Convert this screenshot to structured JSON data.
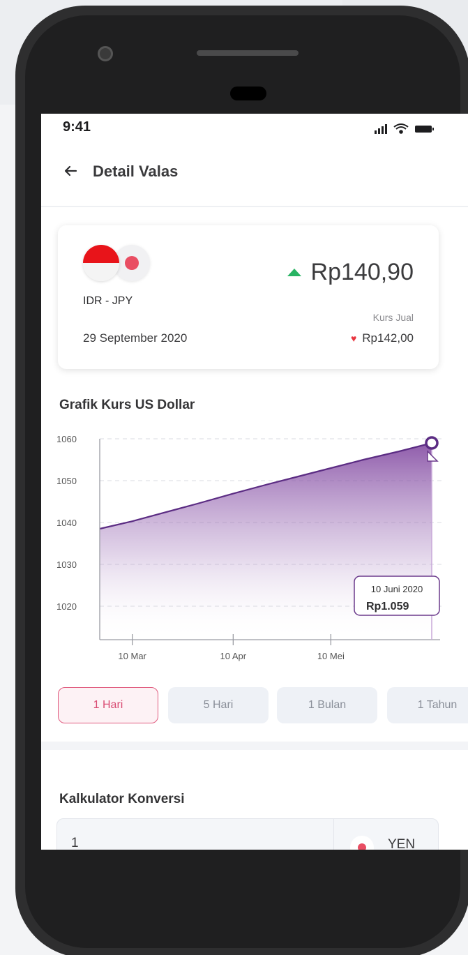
{
  "status_bar": {
    "time": "9:41"
  },
  "header": {
    "title": "Detail Valas"
  },
  "rate_card": {
    "pair": "IDR - JPY",
    "date": "29 September 2020",
    "buy_value": "Rp140,90",
    "sell_label": "Kurs Jual",
    "sell_value": "Rp142,00"
  },
  "chart": {
    "section_title": "Grafik Kurs US Dollar",
    "tooltip_date": "10 Juni 2020",
    "tooltip_value": "Rp1.059"
  },
  "chart_data": {
    "type": "area",
    "title": "Grafik Kurs US Dollar",
    "y_ticks": [
      1060,
      1050,
      1040,
      1030,
      1020
    ],
    "ylim": [
      1012,
      1062
    ],
    "x_tick_labels": [
      "10 Mar",
      "10 Apr",
      "10 Mei"
    ],
    "x_tick_days": [
      10,
      41,
      71
    ],
    "xlim": [
      0,
      102
    ],
    "series": [
      {
        "x": [
          0,
          10,
          20,
          30,
          41,
          51,
          61,
          71,
          81,
          92,
          102
        ],
        "y": [
          1038.5,
          1040.3,
          1042.4,
          1044.5,
          1046.9,
          1049.0,
          1051.0,
          1053.0,
          1055.0,
          1057.0,
          1059.0
        ]
      }
    ],
    "highlight": {
      "x": 102,
      "y": 1059,
      "label": "10 Juni 2020",
      "value": "Rp1.059"
    },
    "grid": "dashed-horizontal"
  },
  "period_tabs": [
    {
      "label": "1 Hari",
      "active": true
    },
    {
      "label": "5 Hari",
      "active": false
    },
    {
      "label": "1 Bulan",
      "active": false
    },
    {
      "label": "1 Tahun",
      "active": false
    }
  ],
  "calculator": {
    "title": "Kalkulator Konversi",
    "amount": "1",
    "currency": "YEN"
  },
  "colors": {
    "up": "#28b463",
    "down": "#e8343f",
    "chart_line": "#5b2c83",
    "active_tab": "#d94c73"
  }
}
